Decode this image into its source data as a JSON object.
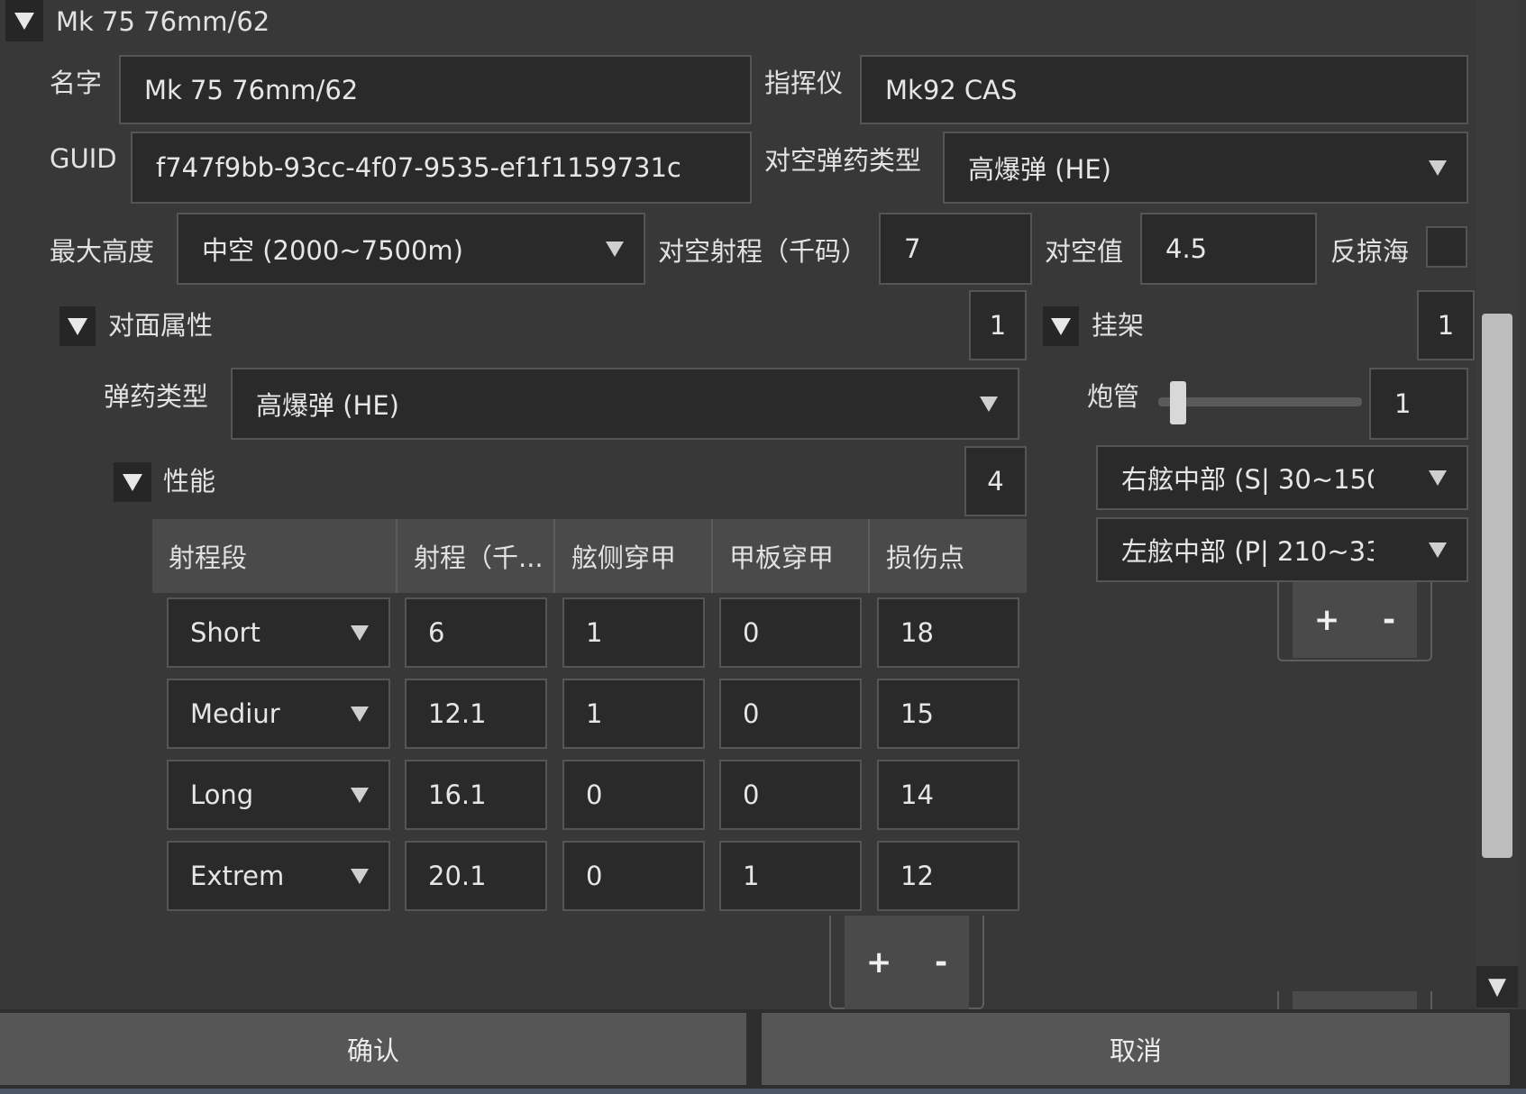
{
  "header": {
    "title": "Mk 75 76mm/62"
  },
  "form": {
    "name_label": "名字",
    "name_value": "Mk 75 76mm/62",
    "director_label": "指挥仪",
    "director_value": "Mk92 CAS",
    "guid_label": "GUID",
    "guid_value": "f747f9bb-93cc-4f07-9535-ef1f1159731c",
    "aa_ammo_label": "对空弹药类型",
    "aa_ammo_value": "高爆弹 (HE)",
    "max_alt_label": "最大高度",
    "max_alt_value": "中空 (2000~7500m)",
    "aa_range_label": "对空射程（千码）",
    "aa_range_value": "7",
    "aa_value_label": "对空值",
    "aa_value_value": "4.5",
    "anti_skim_label": "反掠海",
    "anti_skim_checked": false
  },
  "surface": {
    "title": "对面属性",
    "count": "1",
    "ammo_label": "弹药类型",
    "ammo_value": "高爆弹 (HE)",
    "performance": {
      "title": "性能",
      "count": "4",
      "columns": [
        "射程段",
        "射程（千...",
        "舷侧穿甲",
        "甲板穿甲",
        "损伤点"
      ],
      "rows": [
        {
          "band": "Short",
          "range": "6",
          "belt": "1",
          "deck": "0",
          "damage": "18"
        },
        {
          "band": "Mediur",
          "range": "12.1",
          "belt": "1",
          "deck": "0",
          "damage": "15"
        },
        {
          "band": "Long",
          "range": "16.1",
          "belt": "0",
          "deck": "0",
          "damage": "14"
        },
        {
          "band": "Extrem",
          "range": "20.1",
          "belt": "0",
          "deck": "1",
          "damage": "12"
        }
      ]
    },
    "add_label": "+",
    "remove_label": "-"
  },
  "mount": {
    "title": "挂架",
    "count": "1",
    "barrel_label": "炮管",
    "barrel_value": "1",
    "barrel_slider_fraction": 0.0,
    "positions": [
      "右舷中部 (S| 30~150",
      "左舷中部 (P| 210~33"
    ],
    "add_label": "+",
    "remove_label": "-"
  },
  "footer": {
    "confirm_label": "确认",
    "cancel_label": "取消"
  },
  "scroll": {
    "down_arrow": "▼"
  }
}
